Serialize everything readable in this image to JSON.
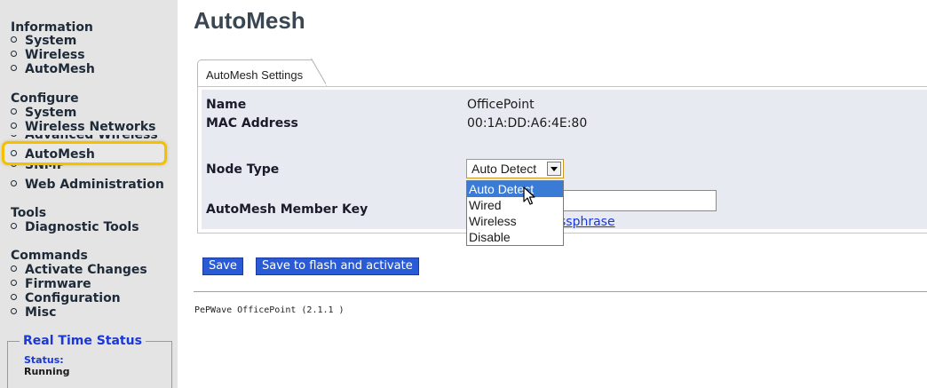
{
  "sidebar": {
    "sections": [
      {
        "title": "Information",
        "items": [
          "System",
          "Wireless",
          "AutoMesh"
        ]
      },
      {
        "title": "Configure",
        "items": [
          "System",
          "Wireless Networks",
          "Advanced Wireless",
          "AutoMesh",
          "SNMP",
          "Web Administration"
        ]
      },
      {
        "title": "Tools",
        "items": [
          "Diagnostic Tools"
        ]
      },
      {
        "title": "Commands",
        "items": [
          "Activate Changes",
          "Firmware",
          "Configuration",
          "Misc"
        ]
      }
    ],
    "real_time_status": {
      "title": "Real Time Status",
      "status_label": "Status:",
      "status_value": "Running"
    },
    "highlight_color": "#f5c000"
  },
  "main": {
    "title": "AutoMesh",
    "tab_label": "AutoMesh Settings",
    "fields": {
      "name_label": "Name",
      "name_value": "OfficePoint",
      "mac_label": "MAC Address",
      "mac_value": "00:1A:DD:A6:4E:80",
      "node_type_label": "Node Type",
      "node_type_value": "Auto Detect",
      "member_key_label": "AutoMesh Member Key",
      "member_key_value": "",
      "passphrase_link_visible": "ssphrase"
    },
    "node_type_options": [
      "Auto Detect",
      "Wired",
      "Wireless",
      "Disable"
    ],
    "selected_option": "Auto Detect",
    "buttons": {
      "save": "Save",
      "save_flash": "Save to flash and activate"
    },
    "footer": "PePWave OfficePoint (2.1.1 )"
  },
  "colors": {
    "accent_blue": "#2a5bd6",
    "link_blue": "#1a37d8",
    "panel_bg": "#e8eaf2",
    "sidebar_bg": "#e4e4e4"
  }
}
